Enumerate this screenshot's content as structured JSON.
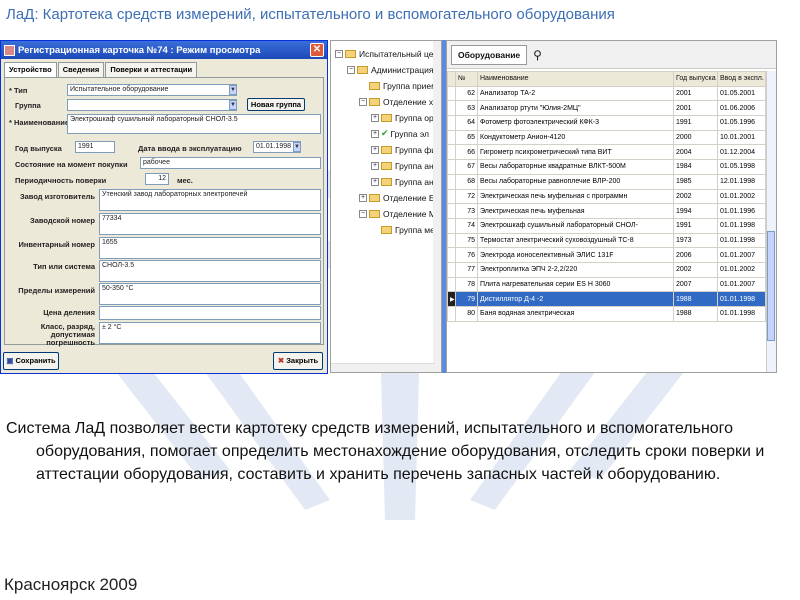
{
  "slide": {
    "title": "ЛаД: Картотека средств измерений, испытательного и вспомогательного оборудования",
    "body": "Система ЛаД позволяет вести картотеку средств измерений, испытательного и вспомогательного оборудования, помогает определить  местонахождение оборудования, отследить сроки поверки и аттестации оборудования, составить и хранить перечень запасных частей к оборудованию.",
    "footer": "Красноярск 2009",
    "colors": {
      "title": "#3d6fb5",
      "selection": "#316ac5",
      "titlebar": "#1c4ab8"
    }
  },
  "dialog": {
    "title": "Регистрационная карточка №74 : Режим просмотра",
    "tabs": [
      "Устройство",
      "Сведения",
      "Поверки и аттестации"
    ],
    "labels": {
      "type": "* Тип",
      "group": "Группа",
      "name": "* Наименование",
      "year": "Год выпуска",
      "date_in": "Дата ввода в эксплуатацию",
      "condition": "Состояние на момент покупки",
      "period": "Периодичность поверки",
      "period_unit": "мес.",
      "maker": "Завод изготовитель",
      "serial": "Заводской номер",
      "inventory": "Инвентарный номер",
      "type_system": "Тип или система",
      "limits": "Пределы измерений",
      "division": "Цена деления",
      "class": "Класс, разряд, допустимая погрешность"
    },
    "values": {
      "type": "Испытательное оборудование",
      "group": "",
      "name": "Электрошкаф сушильный лабораторный СНОЛ-3.5",
      "year": "1991",
      "date_in": "01.01.1998",
      "condition": "рабочее",
      "period": "12",
      "maker": "Утенский завод лабораторных электропечей",
      "serial": "77334",
      "inventory": "1655",
      "type_system": "СНОЛ-3.5",
      "limits": "50-350 °С",
      "division": "",
      "class": "±  2 °С"
    },
    "new_group_button": "Новая группа",
    "save_button": "Сохранить",
    "close_button": "Закрыть"
  },
  "tree": {
    "nodes": [
      {
        "label": "Испытательный цен",
        "sign": "−"
      },
      {
        "label": "Администрация",
        "sign": "−"
      },
      {
        "label": "Группа прием",
        "sign": ""
      },
      {
        "label": "Отделение хи",
        "sign": "−"
      },
      {
        "label": "Группа ор",
        "sign": "+"
      },
      {
        "label": "Группа эл",
        "sign": "+"
      },
      {
        "label": "Группа фи",
        "sign": "+"
      },
      {
        "label": "Группа ан",
        "sign": "+"
      },
      {
        "label": "Группа ан",
        "sign": "+"
      },
      {
        "label": "Отделение Ба",
        "sign": "+"
      },
      {
        "label": "Отделение М",
        "sign": "−"
      },
      {
        "label": "Группа ме",
        "sign": ""
      }
    ]
  },
  "grid": {
    "tab": "Оборудование",
    "columns": [
      "№",
      "Наименование",
      "Год выпуска",
      "Ввод в экспл."
    ],
    "rows": [
      {
        "n": "62",
        "name": "Анализатор  ТА-2",
        "year": "2001",
        "date": "01.05.2001"
      },
      {
        "n": "63",
        "name": "Анализатор  ртути \"Юлия-2МЦ\"",
        "year": "2001",
        "date": "01.06.2006"
      },
      {
        "n": "64",
        "name": "Фотометр фотоэлектрический КФК-3",
        "year": "1991",
        "date": "01.05.1996"
      },
      {
        "n": "65",
        "name": "Кондуктометр Анион-4120",
        "year": "2000",
        "date": "10.01.2001"
      },
      {
        "n": "66",
        "name": "Гигрометр психрометрический типа ВИТ",
        "year": "2004",
        "date": "01.12.2004"
      },
      {
        "n": "67",
        "name": "Весы лабораторные квадратные ВЛКТ-500М",
        "year": "1984",
        "date": "01.05.1998"
      },
      {
        "n": "68",
        "name": "Весы лабораторные равноплечие ВЛР-200",
        "year": "1985",
        "date": "12.01.1998"
      },
      {
        "n": "72",
        "name": "Электрическая печь муфельная с программн",
        "year": "2002",
        "date": "01.01.2002"
      },
      {
        "n": "73",
        "name": "Электрическая печь муфельная",
        "year": "1994",
        "date": "01.01.1996"
      },
      {
        "n": "74",
        "name": "Электрошкаф сушильный лабораторный СНОЛ-",
        "year": "1991",
        "date": "01.01.1998"
      },
      {
        "n": "75",
        "name": "Термостат электрический суховоздушный ТС-8",
        "year": "1973",
        "date": "01.01.1998"
      },
      {
        "n": "76",
        "name": "Электрода ионоселективный ЭЛИС 131F",
        "year": "2006",
        "date": "01.01.2007"
      },
      {
        "n": "77",
        "name": "Электроплитка ЭПЧ 2-2,2/220",
        "year": "2002",
        "date": "01.01.2002"
      },
      {
        "n": "78",
        "name": "Плита нагревательная серии ES Н 3060",
        "year": "2007",
        "date": "01.01.2007"
      },
      {
        "n": "79",
        "name": "Дистиллятор Д-4 -2",
        "year": "1988",
        "date": "01.01.1998",
        "selected": true
      },
      {
        "n": "80",
        "name": "Баня водяная электрическая",
        "year": "1988",
        "date": "01.01.1998"
      }
    ]
  }
}
